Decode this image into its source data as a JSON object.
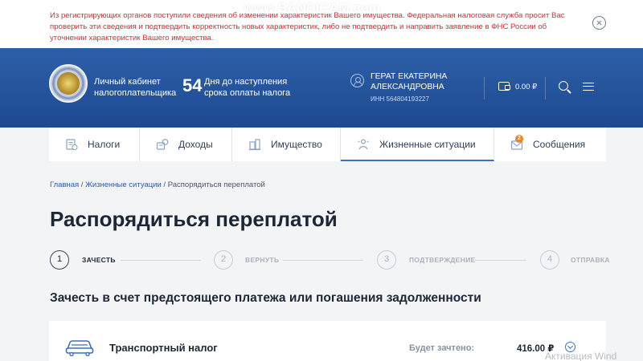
{
  "alert": {
    "message": "Из регистрирующих органов поступили сведения об изменении характеристик Вашего имущества. Федеральная налоговая служба просит Вас проверить эти сведения и подтвердить корректность новых характеристик, либо не подтвердить и направить заявление в ФНС России об уточнении характеристик Вашего имущества."
  },
  "watermarks": {
    "recorder": "www.BANDICAM.com",
    "windows": "Активация Wind"
  },
  "header": {
    "cabinet_title": "Личный кабинет налогоплательщика",
    "days_count": "54",
    "days_text": "Дня до наступления срока оплаты налога",
    "user_name": "ГЕРАТ ЕКАТЕРИНА АЛЕКСАНДРОВНА",
    "inn": "ИНН 564804193227",
    "balance": "0.00 ₽"
  },
  "tabs": [
    {
      "label": "Налоги",
      "icon": "taxes-icon"
    },
    {
      "label": "Доходы",
      "icon": "income-icon"
    },
    {
      "label": "Имущество",
      "icon": "property-icon"
    },
    {
      "label": "Жизненные ситуации",
      "icon": "life-situations-icon",
      "active": true
    },
    {
      "label": "Сообщения",
      "icon": "messages-icon",
      "badge": "2"
    }
  ],
  "breadcrumb": {
    "home": "Главная",
    "section": "Жизненные ситуации",
    "current": "Распорядиться переплатой",
    "separator": " / "
  },
  "page_title": "Распорядиться переплатой",
  "steps": [
    {
      "number": "1",
      "label": "ЗАЧЕСТЬ",
      "active": true
    },
    {
      "number": "2",
      "label": "ВЕРНУТЬ",
      "active": false
    },
    {
      "number": "3",
      "label": "ПОДТВЕРЖДЕНИЕ",
      "active": false
    },
    {
      "number": "4",
      "label": "ОТПРАВКА",
      "active": false
    }
  ],
  "subtitle": "Зачесть в счет предстоящего платежа или погашения задолженности",
  "tax_item": {
    "name": "Транспортный налог",
    "credit_label": "Будет зачтено:",
    "credit_amount": "416.00 ₽",
    "icon": "car-icon"
  },
  "colors": {
    "header_blue": "#2456a0",
    "alert_red": "#d0313a",
    "accent": "#3a71c2",
    "badge_orange": "#e8852d"
  }
}
